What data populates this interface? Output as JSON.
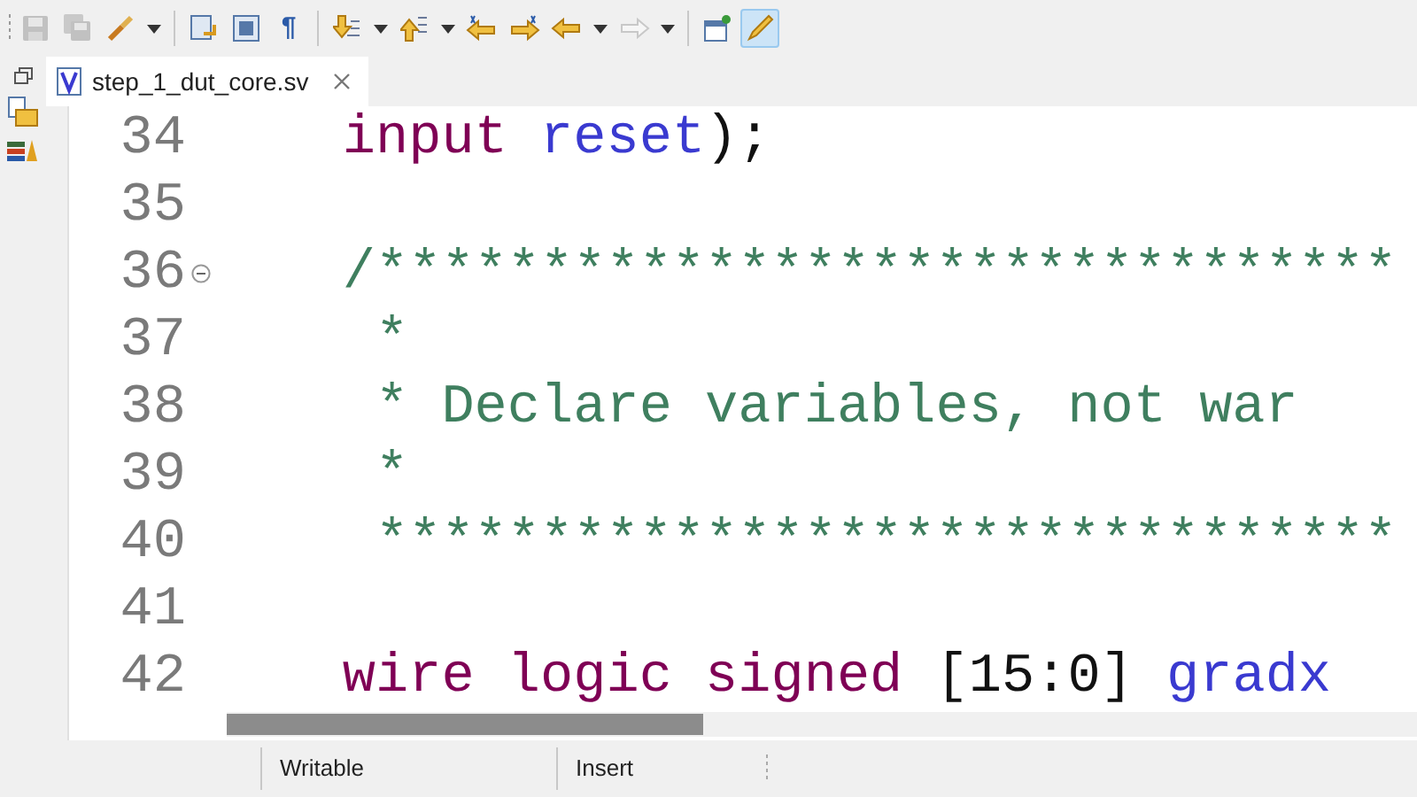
{
  "toolbar": [
    {
      "kind": "button",
      "disabled": true,
      "selected": false
    },
    {
      "kind": "button",
      "disabled": true,
      "selected": false
    },
    {
      "kind": "button",
      "disabled": false,
      "selected": false,
      "dropdown": true
    },
    {
      "kind": "separator"
    },
    {
      "kind": "button",
      "disabled": false,
      "selected": false
    },
    {
      "kind": "button",
      "disabled": false,
      "selected": false
    },
    {
      "kind": "glyph",
      "text": "¶",
      "selected": false
    },
    {
      "kind": "separator"
    },
    {
      "kind": "button",
      "disabled": false,
      "selected": false,
      "dropdown": true
    },
    {
      "kind": "button",
      "disabled": false,
      "selected": false,
      "dropdown": true
    },
    {
      "kind": "button",
      "disabled": false,
      "selected": false
    },
    {
      "kind": "button",
      "disabled": false,
      "selected": false
    },
    {
      "kind": "button",
      "disabled": false,
      "selected": false,
      "dropdown": true
    },
    {
      "kind": "button",
      "disabled": true,
      "selected": false,
      "dropdown": true
    },
    {
      "kind": "separator"
    },
    {
      "kind": "button",
      "disabled": false,
      "selected": false
    },
    {
      "kind": "button",
      "disabled": false,
      "selected": true
    }
  ],
  "tabs": [
    {
      "label": "step_1_dut_core.sv",
      "selected": true
    }
  ],
  "editor": {
    "lines": [
      {
        "number": "34",
        "kind": "statement",
        "tokens": [
          {
            "kind": "keyword",
            "text": "input"
          },
          {
            "kind": "identifier",
            "text": "reset"
          },
          {
            "kind": "punct",
            "text": ");"
          }
        ]
      },
      {
        "number": "35",
        "kind": "blank"
      },
      {
        "number": "36",
        "kind": "comment_start",
        "fold": true,
        "tokens": [
          {
            "kind": "comment",
            "text": "/*******************************"
          }
        ]
      },
      {
        "number": "37",
        "kind": "comment_line",
        "tokens": [
          {
            "kind": "comment",
            "text": "*"
          }
        ]
      },
      {
        "number": "38",
        "kind": "comment_line",
        "tokens": [
          {
            "kind": "comment",
            "text": "* Declare variables, not war"
          }
        ]
      },
      {
        "number": "39",
        "kind": "comment_line",
        "tokens": [
          {
            "kind": "comment",
            "text": "*"
          }
        ]
      },
      {
        "number": "40",
        "kind": "comment_line",
        "tokens": [
          {
            "kind": "comment",
            "text": "*******************************"
          }
        ]
      },
      {
        "number": "41",
        "kind": "blank"
      },
      {
        "number": "42",
        "kind": "statement",
        "tokens": [
          {
            "kind": "keyword",
            "text": "wire logic signed"
          },
          {
            "kind": "plain",
            "text": "[15:0]"
          },
          {
            "kind": "identifier",
            "text": "gradx"
          }
        ]
      }
    ],
    "scrollbar": {
      "level": 0.4
    }
  },
  "status_bar": [
    {
      "text": "Writable"
    },
    {
      "text": "Insert"
    }
  ]
}
